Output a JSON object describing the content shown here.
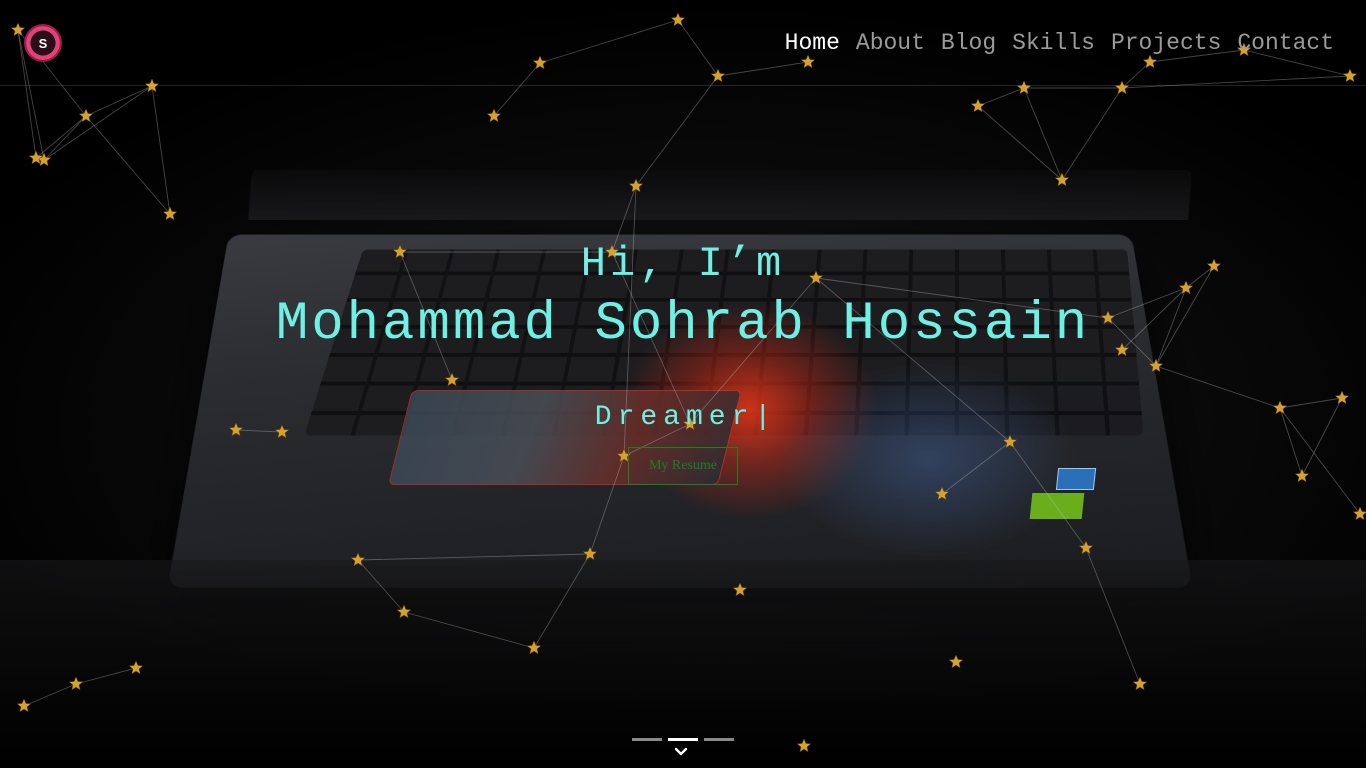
{
  "header": {
    "logo_letter": "S",
    "nav": [
      {
        "label": "Home",
        "active": true
      },
      {
        "label": "About",
        "active": false
      },
      {
        "label": "Blog",
        "active": false
      },
      {
        "label": "Skills",
        "active": false
      },
      {
        "label": "Projects",
        "active": false
      },
      {
        "label": "Contact",
        "active": false
      }
    ]
  },
  "hero": {
    "greeting": "Hi, I’m",
    "name": "Mohammad Sohrab Hossain",
    "typed_word": "Dreamer",
    "cursor": "|",
    "resume_button": "My Resume"
  },
  "slider": {
    "slide_count": 3,
    "active_index": 1
  },
  "icons": {
    "logo": "logo-icon",
    "scroll": "chevron-down-icon",
    "decoration": "star-icon"
  },
  "colors": {
    "accent": "#6ff0e4",
    "resume_button": "#1f7d2a",
    "nav_active": "#ffffff",
    "nav_inactive": "#9a9a9a",
    "star": "#d7a22b",
    "logo": "#e0427a"
  }
}
